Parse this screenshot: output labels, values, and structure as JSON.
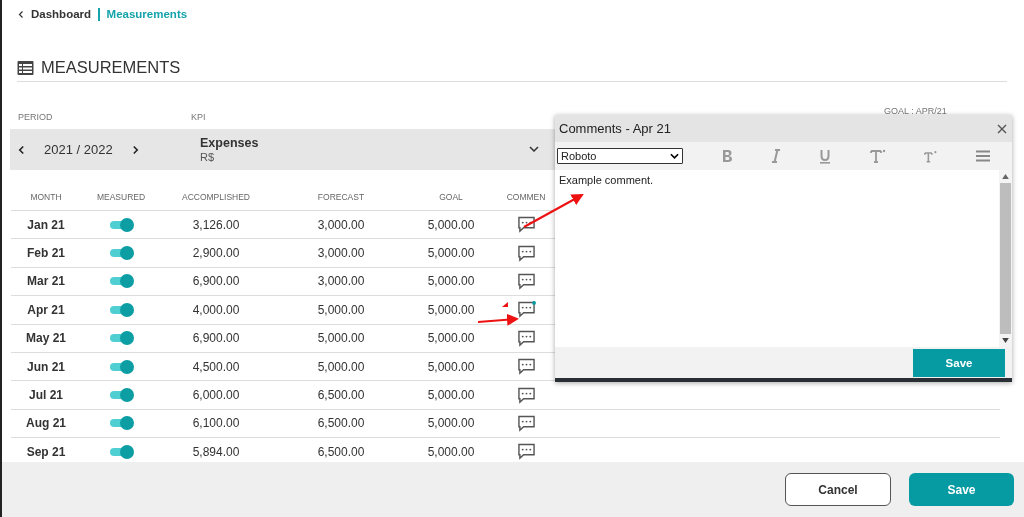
{
  "breadcrumb": {
    "back": "Dashboard",
    "current": "Measurements"
  },
  "title": "MEASUREMENTS",
  "filters": {
    "period_label": "PERIOD",
    "period": "2021 / 2022",
    "kpi_label": "KPI",
    "kpi": "Expenses",
    "kpi_unit": "R$",
    "goal_label": "GOAL : APR/21"
  },
  "table": {
    "columns": [
      "MONTH",
      "MEASURED",
      "ACCOMPLISHED",
      "FORECAST",
      "GOAL",
      "COMMEN"
    ],
    "rows": [
      {
        "month": "Jan 21",
        "measured": true,
        "accomplished": "3,126.00",
        "forecast": "3,000.00",
        "goal": "5,000.00",
        "has_comment": false
      },
      {
        "month": "Feb 21",
        "measured": true,
        "accomplished": "2,900.00",
        "forecast": "3,000.00",
        "goal": "5,000.00",
        "has_comment": false
      },
      {
        "month": "Mar 21",
        "measured": true,
        "accomplished": "6,900.00",
        "forecast": "3,000.00",
        "goal": "5,000.00",
        "has_comment": false
      },
      {
        "month": "Apr 21",
        "measured": true,
        "accomplished": "4,000.00",
        "forecast": "5,000.00",
        "goal": "5,000.00",
        "has_comment": true
      },
      {
        "month": "May 21",
        "measured": true,
        "accomplished": "6,900.00",
        "forecast": "5,000.00",
        "goal": "5,000.00",
        "has_comment": false
      },
      {
        "month": "Jun 21",
        "measured": true,
        "accomplished": "4,500.00",
        "forecast": "5,000.00",
        "goal": "5,000.00",
        "has_comment": false
      },
      {
        "month": "Jul 21",
        "measured": true,
        "accomplished": "6,000.00",
        "forecast": "6,500.00",
        "goal": "5,000.00",
        "has_comment": false
      },
      {
        "month": "Aug 21",
        "measured": true,
        "accomplished": "6,100.00",
        "forecast": "6,500.00",
        "goal": "5,000.00",
        "has_comment": false
      },
      {
        "month": "Sep 21",
        "measured": true,
        "accomplished": "5,894.00",
        "forecast": "6,500.00",
        "goal": "5,000.00",
        "has_comment": false
      }
    ]
  },
  "dialog": {
    "title": "Comments - Apr 21",
    "font": "Roboto",
    "text": "Example comment.",
    "save": "Save"
  },
  "footer": {
    "cancel": "Cancel",
    "save": "Save"
  }
}
